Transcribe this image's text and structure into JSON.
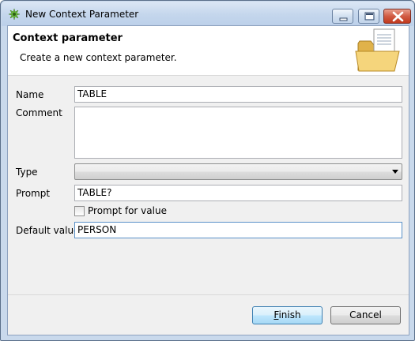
{
  "window": {
    "title": "New Context Parameter"
  },
  "banner": {
    "title": "Context parameter",
    "description": "Create a new context parameter.",
    "icon": "folder-document-icon"
  },
  "form": {
    "name_label": "Name",
    "name_value": "TABLE",
    "comment_label": "Comment",
    "comment_value": "",
    "type_label": "Type",
    "type_value": "",
    "prompt_label": "Prompt",
    "prompt_value": "TABLE?",
    "prompt_for_value_label": "Prompt for value",
    "prompt_for_value_checked": false,
    "default_label": "Default value",
    "default_value": "PERSON"
  },
  "buttons": {
    "finish_mnemonic": "F",
    "finish_rest": "inish",
    "cancel": "Cancel"
  }
}
